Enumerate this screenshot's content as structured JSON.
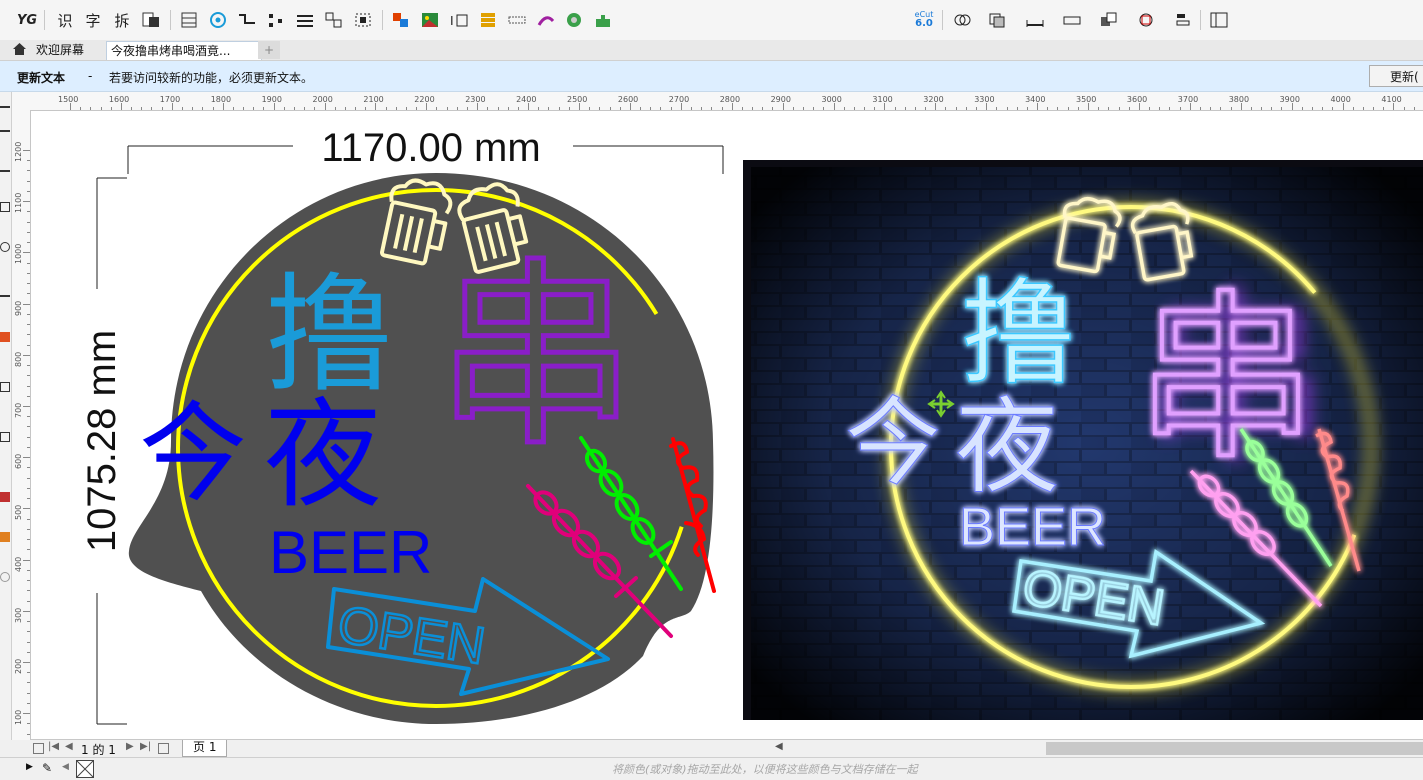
{
  "toolbar": {
    "text_tools": [
      "识",
      "字",
      "拆"
    ],
    "ecut": {
      "top": "eCut",
      "bottom": "6.0"
    }
  },
  "tabs": {
    "welcome": "欢迎屏幕",
    "document": "今夜撸串烤串喝酒竟...",
    "add": "+"
  },
  "notice": {
    "title": "更新文本",
    "dash": "-",
    "message": "若要访问较新的功能，必须更新文本。",
    "button": "更新("
  },
  "ruler": {
    "h_labels": [
      "1500",
      "1600",
      "1700",
      "1800",
      "1900",
      "2000",
      "2100",
      "2200",
      "2300",
      "2400",
      "2500",
      "2600",
      "2700",
      "2800",
      "2900",
      "3000",
      "3100",
      "3200",
      "3300",
      "3400",
      "3500",
      "3600",
      "3700",
      "3800",
      "3900",
      "4000",
      "4100"
    ],
    "v_labels": [
      "1200",
      "1100",
      "1000",
      "900",
      "800",
      "700",
      "600",
      "500",
      "400",
      "300",
      "200",
      "100"
    ]
  },
  "dimensions": {
    "width": "1170.00 mm",
    "height": "1075.28 mm"
  },
  "sign": {
    "char_lu": "撸",
    "char_chuan": "串",
    "char_jin": "今",
    "char_ye": "夜",
    "beer": "BEER",
    "open": "OPEN"
  },
  "colors": {
    "board": "#505050",
    "ring": "#ffff00",
    "lu": "#1a9bd8",
    "chuan": "#8a1ec8",
    "jinye": "#0000ee",
    "open": "#0a8fd8",
    "mug": "#fff8c0",
    "green_skewer": "#00ee00",
    "pink_skewer": "#e0007a",
    "red_skewer": "#ff0000"
  },
  "pagebar": {
    "page_of": "1 的 1",
    "page_tab": "页 1"
  },
  "colorbar": {
    "hint": "将颜色(或对象)拖动至此处，以便将这些颜色与文档存储在一起"
  }
}
